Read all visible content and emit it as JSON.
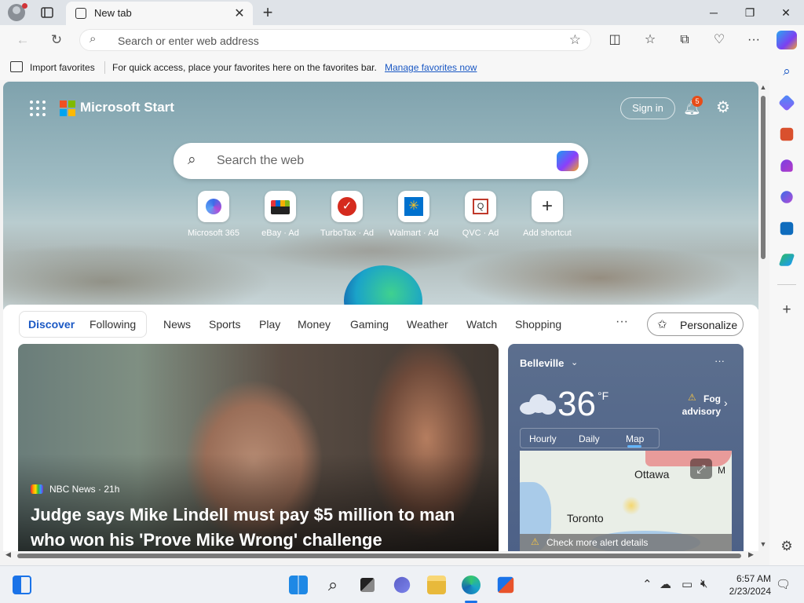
{
  "browser": {
    "tab_title": "New tab",
    "address_placeholder": "Search or enter web address"
  },
  "favorites_bar": {
    "import_label": "Import favorites",
    "message": "For quick access, place your favorites here on the favorites bar.",
    "manage_link": "Manage favorites now"
  },
  "start": {
    "brand": "Microsoft Start",
    "sign_in": "Sign in",
    "notifications_count": "5",
    "search_placeholder": "Search the web",
    "tiles": [
      {
        "label": "Microsoft 365",
        "icon": "microsoft-365-icon"
      },
      {
        "label": "eBay · Ad",
        "icon": "ebay-icon"
      },
      {
        "label": "TurboTax · Ad",
        "icon": "turbotax-icon"
      },
      {
        "label": "Walmart · Ad",
        "icon": "walmart-icon"
      },
      {
        "label": "QVC · Ad",
        "icon": "qvc-icon"
      },
      {
        "label": "Add shortcut",
        "icon": "plus-icon"
      }
    ]
  },
  "feed_tabs": {
    "discover": "Discover",
    "following": "Following",
    "items": [
      "News",
      "Sports",
      "Play",
      "Money",
      "Gaming",
      "Weather",
      "Watch",
      "Shopping"
    ],
    "more": "···",
    "personalize": "Personalize"
  },
  "news_card": {
    "source": "NBC News · 21h",
    "headline": "Judge says Mike Lindell must pay $5 million to man who won his 'Prove Mike Wrong' challenge"
  },
  "weather_card": {
    "location": "Belleville",
    "temperature": "36",
    "unit": "°F",
    "alert": "Fog advisory",
    "tabs": [
      "Hourly",
      "Daily",
      "Map"
    ],
    "selected_tab": "Map",
    "map_cities": [
      "Ottawa",
      "Toronto",
      "M"
    ],
    "alert_bar": "Check more alert details"
  },
  "taskbar": {
    "time": "6:57 AM",
    "date": "2/23/2024"
  },
  "colors": {
    "accent": "#1a58c4",
    "badge": "#e74c18",
    "alert": "#f6c544"
  }
}
